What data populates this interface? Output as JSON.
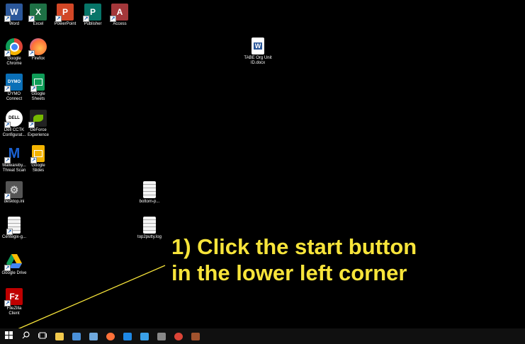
{
  "desktop_icons": [
    {
      "label": "Word",
      "icon": "word-icon",
      "color": "#2b579a",
      "letter": "W"
    },
    {
      "label": "Excel",
      "icon": "excel-icon",
      "color": "#1e7145",
      "letter": "X"
    },
    {
      "label": "PowerPoint",
      "icon": "powerpoint-icon",
      "color": "#d24726",
      "letter": "P"
    },
    {
      "label": "Publisher",
      "icon": "publisher-icon",
      "color": "#077568",
      "letter": "P"
    },
    {
      "label": "Access",
      "icon": "access-icon",
      "color": "#a4373a",
      "letter": "A"
    },
    {
      "label": "Google Chrome",
      "icon": "chrome-icon",
      "color": "#db4437",
      "letter": ""
    },
    {
      "label": "Firefox",
      "icon": "firefox-icon",
      "color": "#ff7139",
      "letter": ""
    },
    {
      "label": "DYMO Connect",
      "icon": "dymo-connect-icon",
      "color": "#0a6fb7",
      "letter": "DYMO"
    },
    {
      "label": "Google Sheets",
      "icon": "google-sheets-icon",
      "color": "#0f9d58",
      "letter": ""
    },
    {
      "label": "Dell CCTK Configurat...",
      "icon": "dell-cctk-icon",
      "color": "#1a1a1a",
      "letter": "DELL"
    },
    {
      "label": "GeForce Experience",
      "icon": "geforce-experience-icon",
      "color": "#76b900",
      "letter": ""
    },
    {
      "label": "Malwareby... Threat Scan",
      "icon": "malwarebytes-icon",
      "color": "#1b61d1",
      "letter": "M"
    },
    {
      "label": "Google Slides",
      "icon": "google-slides-icon",
      "color": "#f4b400",
      "letter": ""
    },
    {
      "label": "desktop.ini",
      "icon": "settings-file-icon",
      "color": "#666",
      "letter": "⚙"
    },
    {
      "label": "Centegix-g...",
      "icon": "text-file-icon",
      "color": "doc",
      "letter": ""
    },
    {
      "label": "Google Drive",
      "icon": "google-drive-icon",
      "color": "#1fa463",
      "letter": ""
    },
    {
      "label": "FileZilla Client",
      "icon": "filezilla-icon",
      "color": "#bf0000",
      "letter": "Fz"
    },
    {
      "label": "TABE Org Unit ID.docx",
      "icon": "word-document-icon",
      "color": "#2b579a",
      "letter": "W"
    },
    {
      "label": "bottom-p...",
      "icon": "text-file-icon",
      "color": "doc",
      "letter": ""
    },
    {
      "label": "top2putty.log",
      "icon": "text-file-icon",
      "color": "doc",
      "letter": ""
    }
  ],
  "annotation": {
    "text": "1) Click the start button\nin the lower left corner"
  },
  "taskbar": {
    "items": [
      {
        "icon": "windows-start-icon",
        "color": "#ffffff"
      },
      {
        "icon": "search-icon",
        "color": "#ffffff"
      },
      {
        "icon": "task-view-icon",
        "color": "#ffffff"
      },
      {
        "icon": "file-explorer-icon",
        "color": "#f2c94c"
      },
      {
        "icon": "remote-desktop-icon",
        "color": "#4a90d9"
      },
      {
        "icon": "network-app-icon",
        "color": "#6fa8dc"
      },
      {
        "icon": "firefox-icon",
        "color": "#ff7139"
      },
      {
        "icon": "store-icon",
        "color": "#1e88e5"
      },
      {
        "icon": "app-icon",
        "color": "#3aa0e8"
      },
      {
        "icon": "terminal-icon",
        "color": "#888888"
      },
      {
        "icon": "chrome-icon",
        "color": "#db4437"
      },
      {
        "icon": "settings-app-icon",
        "color": "#a0522d"
      }
    ]
  }
}
